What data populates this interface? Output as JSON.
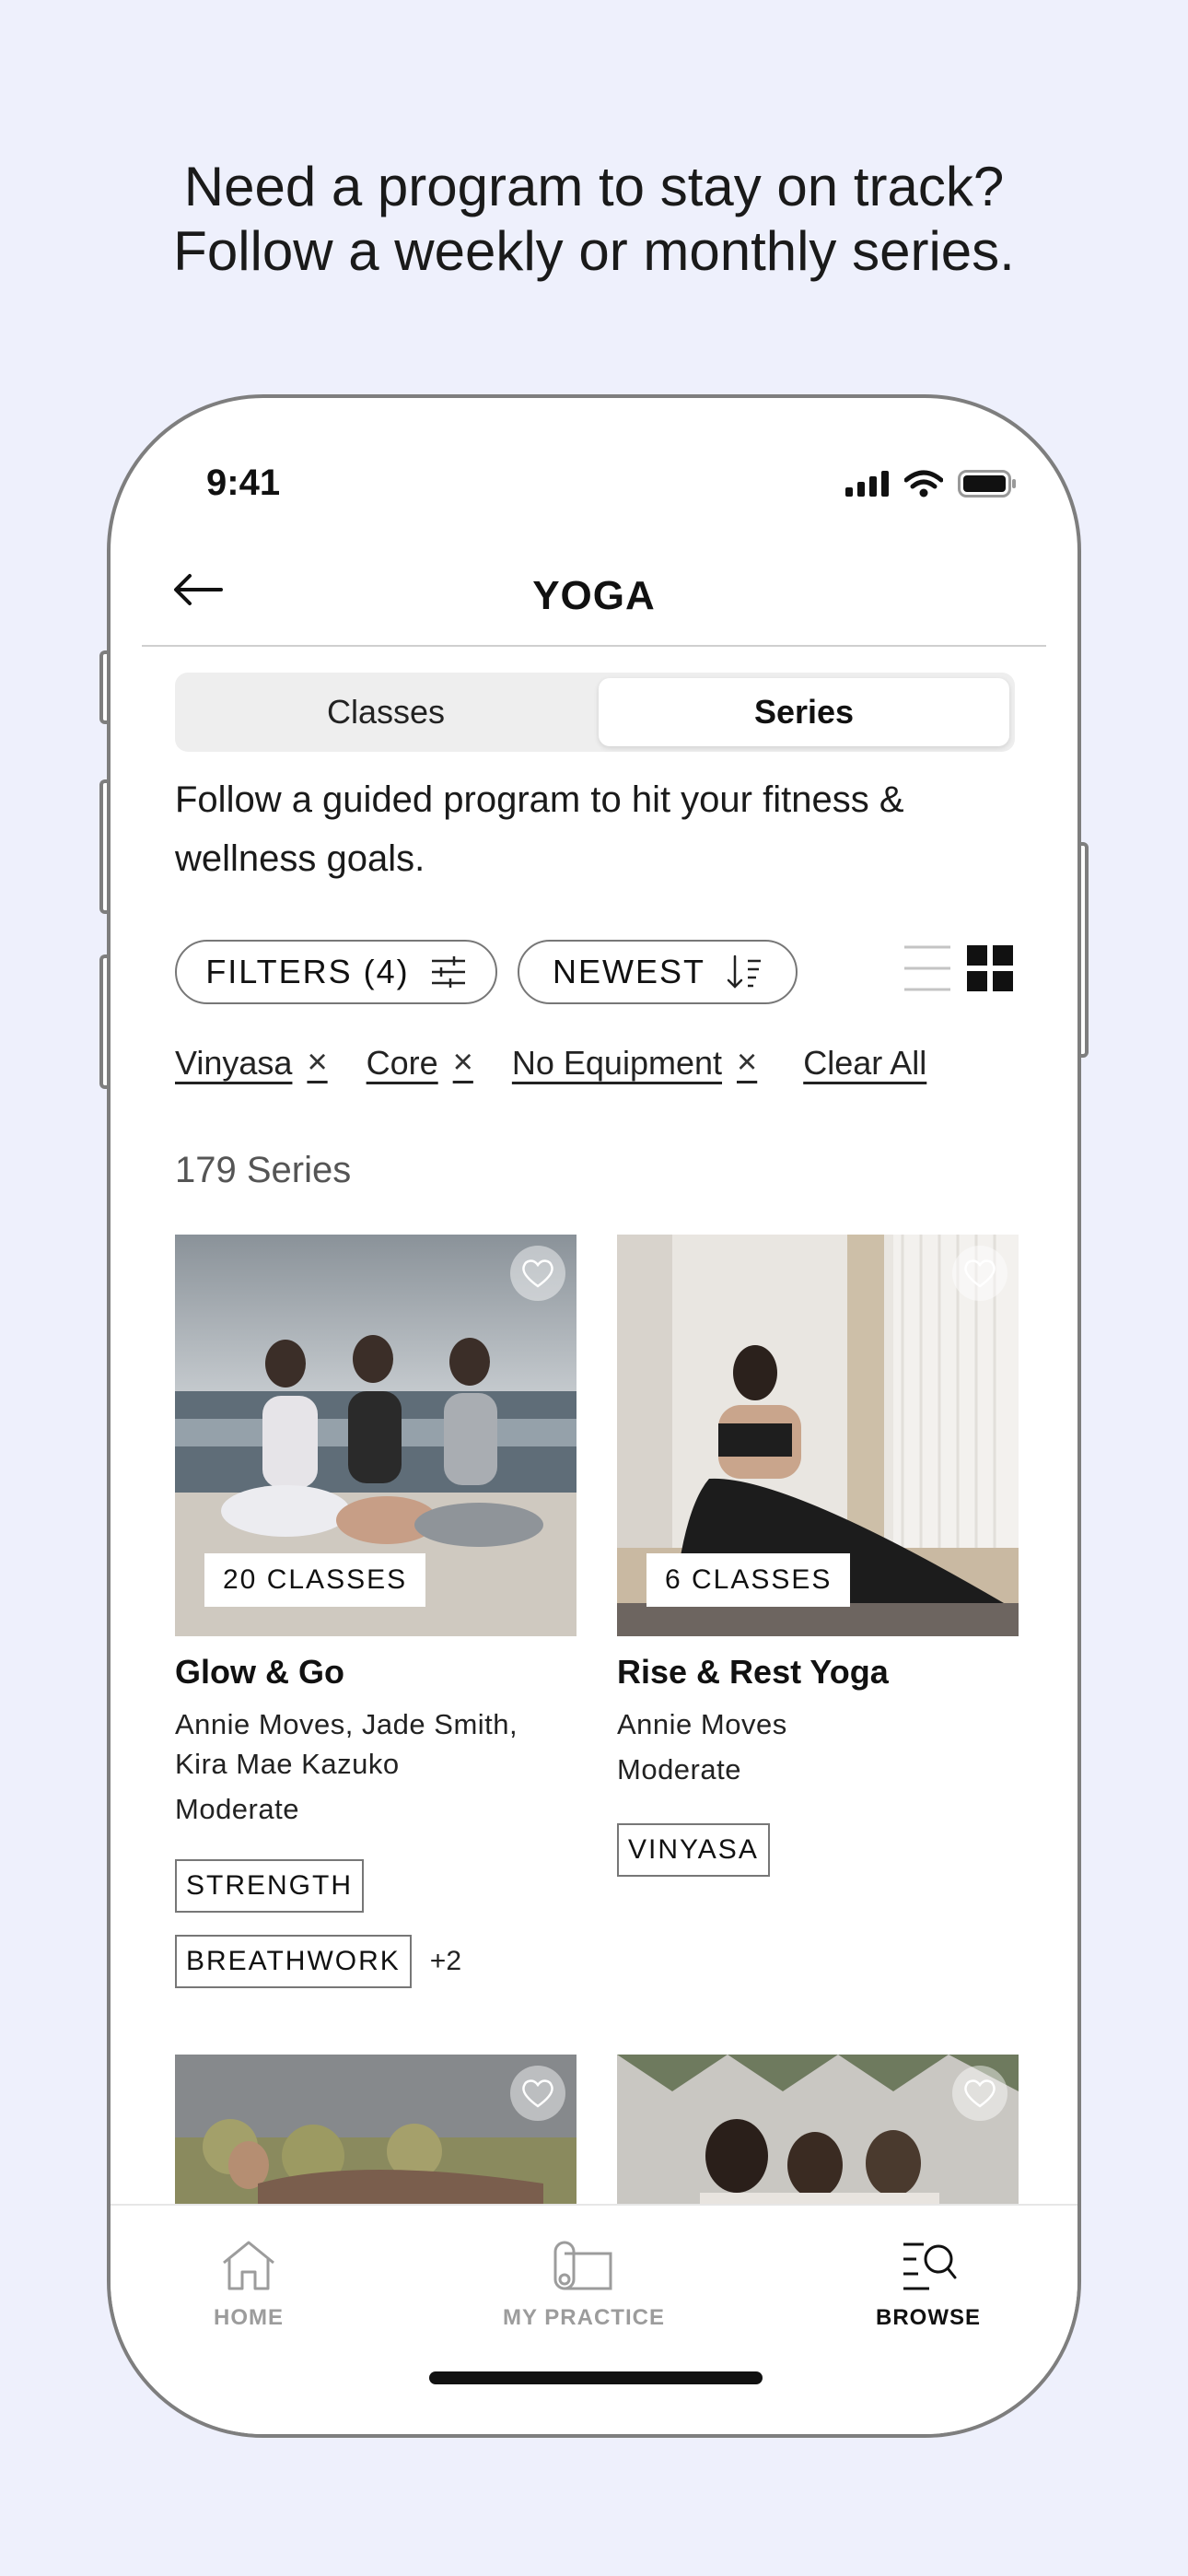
{
  "headline": {
    "line1": "Need a program to stay on track?",
    "line2": "Follow a weekly or monthly series."
  },
  "status_bar": {
    "time": "9:41",
    "icons": [
      "signal-icon",
      "wifi-icon",
      "battery-icon"
    ]
  },
  "nav": {
    "title": "YOGA",
    "back_icon": "arrow-left-icon"
  },
  "segments": {
    "classes": "Classes",
    "series": "Series",
    "selected": "Series"
  },
  "intro_text": "Follow a guided program to hit your fitness & wellness goals.",
  "filters": {
    "filters_label": "FILTERS (4)",
    "sort_label": "NEWEST",
    "view_mode": "grid",
    "active_tags": [
      "Vinyasa",
      "Core",
      "No Equipment"
    ],
    "clear_all": "Clear All"
  },
  "result_count": "179 Series",
  "cards": [
    {
      "badge": "20 CLASSES",
      "title": "Glow & Go",
      "instructors_line1": "Annie Moves, Jade Smith,",
      "instructors_line2": "Kira Mae Kazuko",
      "level": "Moderate",
      "tags": [
        "STRENGTH",
        "BREATHWORK"
      ],
      "more": "+2"
    },
    {
      "badge": "6 CLASSES",
      "title": "Rise & Rest Yoga",
      "instructors_line1": "Annie Moves",
      "level": "Moderate",
      "tags": [
        "VINYASA"
      ]
    }
  ],
  "tabbar": {
    "home": "HOME",
    "practice": "MY PRACTICE",
    "browse": "BROWSE",
    "active": "BROWSE"
  },
  "colors": {
    "background": "#eef0fc",
    "phone_border": "#7e7e7e",
    "inactive_tab": "#9c9c9c"
  }
}
